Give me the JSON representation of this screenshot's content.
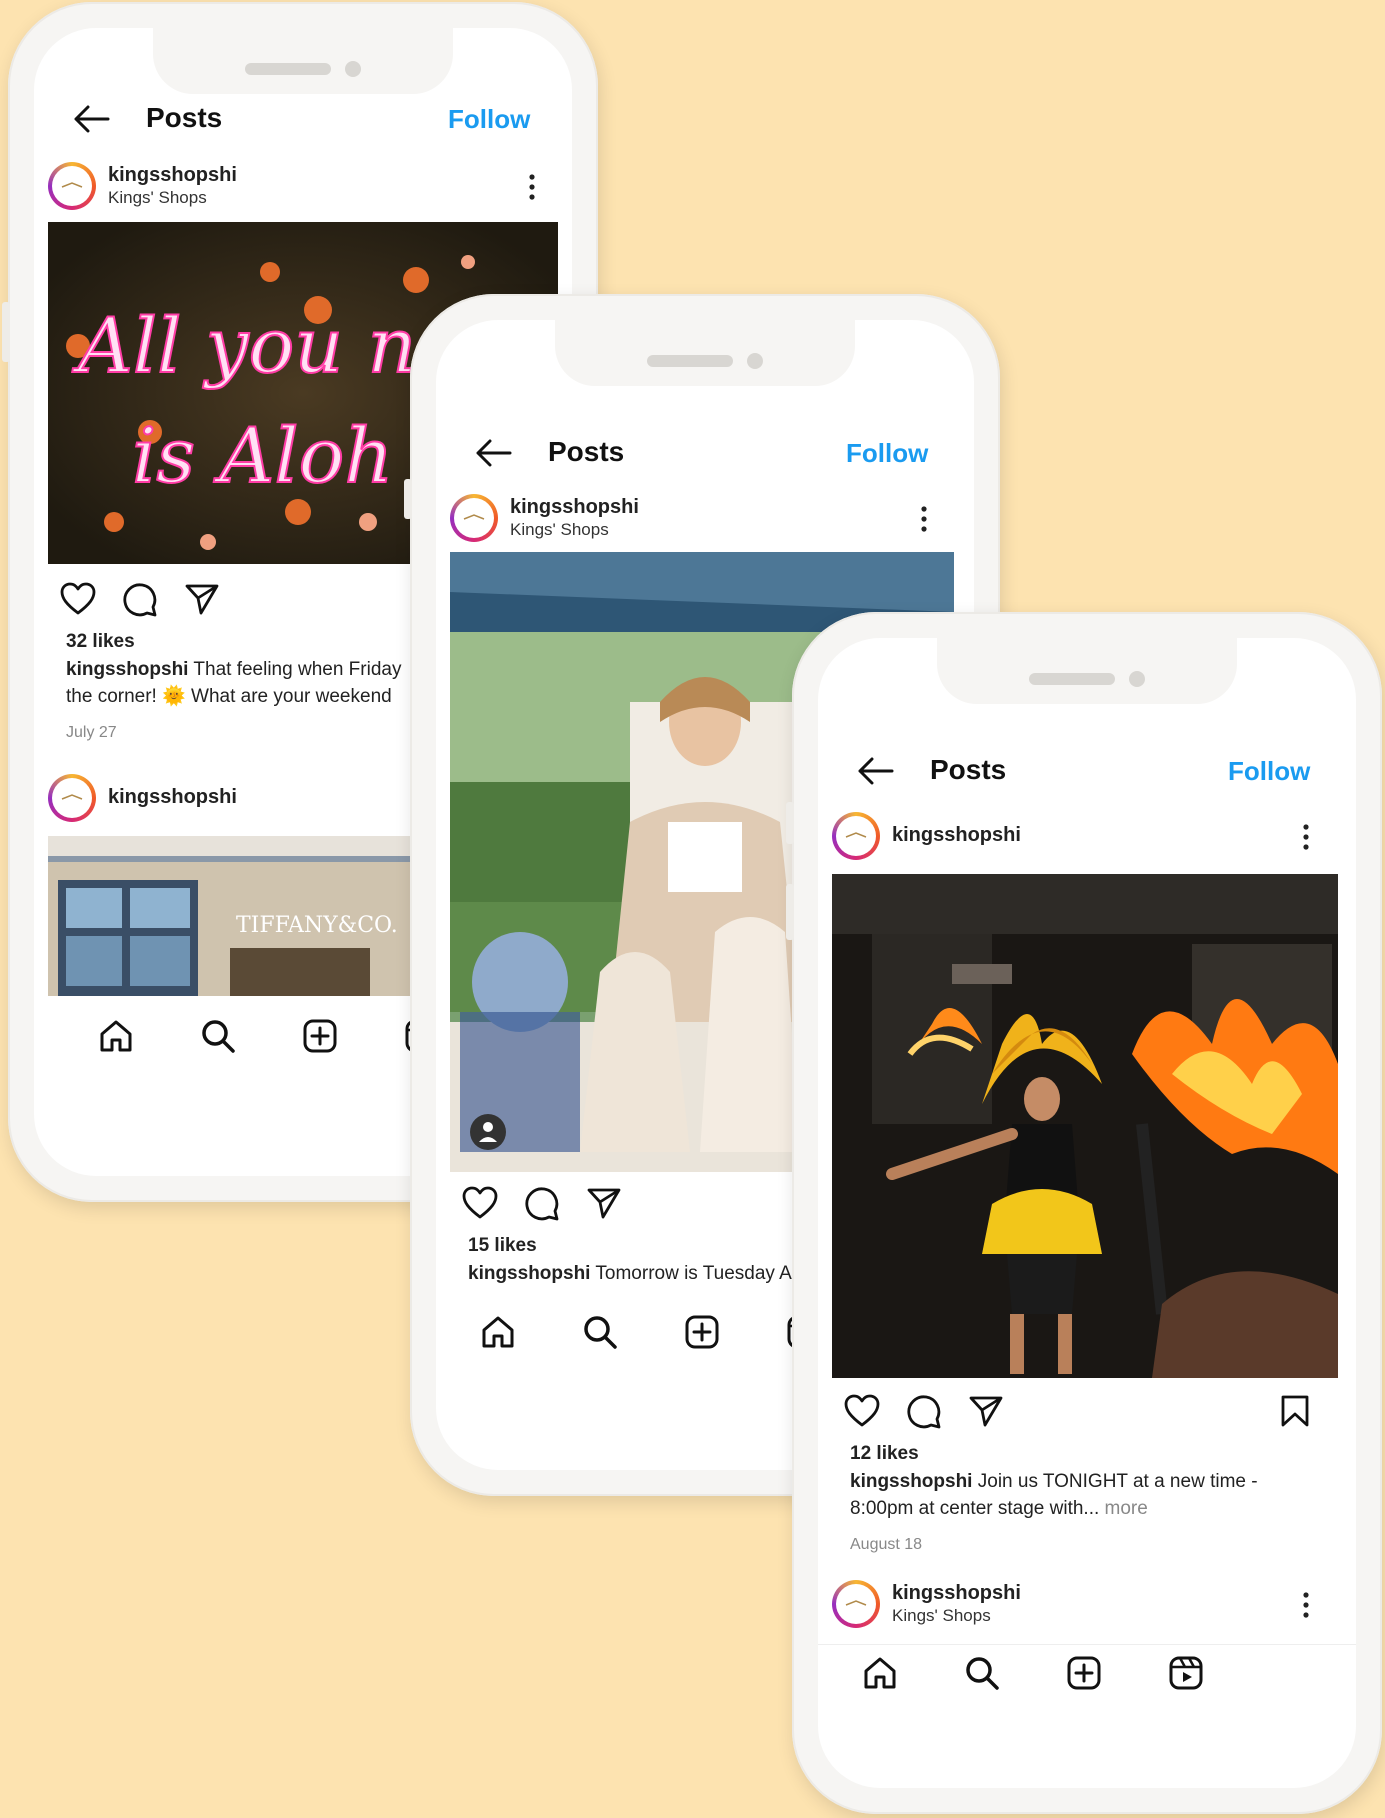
{
  "colors": {
    "background": "#fde3b0",
    "follow_blue": "#1a9bf0",
    "avatar_ring": [
      "#f7b733",
      "#f05a28",
      "#d62976",
      "#962fbf"
    ]
  },
  "header": {
    "title": "Posts",
    "follow_label": "Follow",
    "back_icon": "arrow-left-icon"
  },
  "phones": [
    {
      "post1": {
        "username": "kingsshopshi",
        "location": "Kings' Shops",
        "image_text_line1": "All you ne",
        "image_text_line2": "is Aloh",
        "likes": "32 likes",
        "caption_user": "kingsshopshi",
        "caption_line1": " That feeling when Friday",
        "caption_line2": "the corner! 🌞 What are your weekend",
        "date": "July 27"
      },
      "post2": {
        "username": "kingsshopshi",
        "image_text": "TIFFANY&CO."
      }
    },
    {
      "post1": {
        "username": "kingsshopshi",
        "location": "Kings' Shops",
        "likes": "15 likes",
        "caption_user": "kingsshopshi",
        "caption_line1": " Tomorrow is Tuesday A"
      }
    },
    {
      "post1": {
        "username": "kingsshopshi",
        "likes": "12 likes",
        "caption_user": "kingsshopshi",
        "caption_line1": " Join us TONIGHT at a new time -",
        "caption_line2": "8:00pm at center stage with...",
        "more": "more",
        "date": "August 18"
      },
      "post2": {
        "username": "kingsshopshi",
        "location": "Kings' Shops"
      }
    }
  ],
  "navbar": [
    "home-icon",
    "search-icon",
    "add-post-icon",
    "reels-icon"
  ]
}
